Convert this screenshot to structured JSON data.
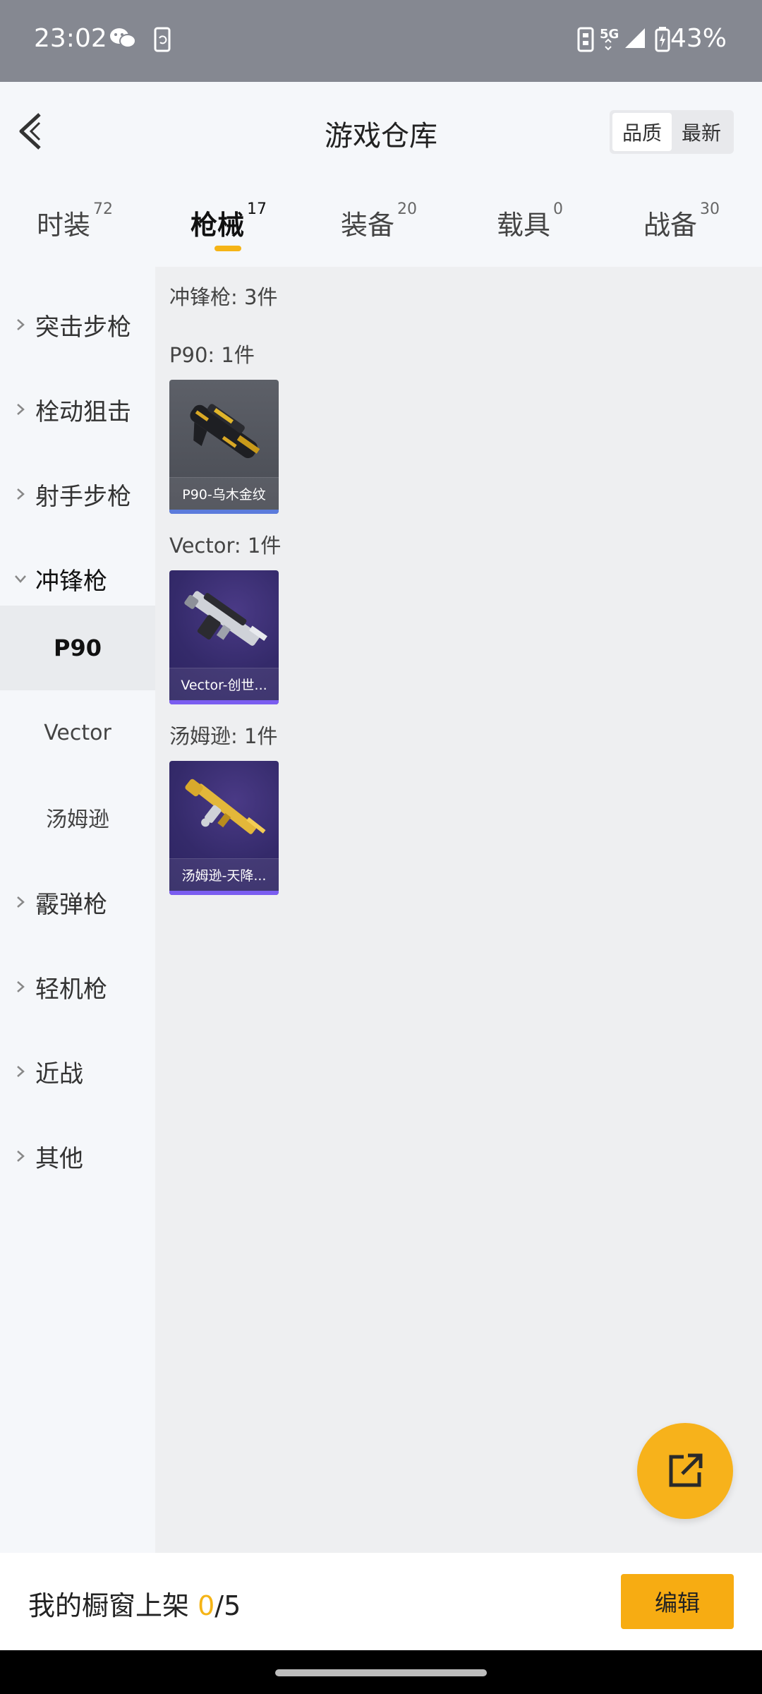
{
  "status_bar": {
    "time": "23:02",
    "battery": "43%",
    "icons": [
      "wechat-icon",
      "phone-sync-icon",
      "nfc-icon",
      "5g-icon",
      "signal-icon",
      "battery-charging-icon"
    ]
  },
  "header": {
    "title": "游戏仓库",
    "sort_options": [
      "品质",
      "最新"
    ],
    "active_sort": "品质"
  },
  "tabs": [
    {
      "label": "时装",
      "count": "72"
    },
    {
      "label": "枪械",
      "count": "17"
    },
    {
      "label": "装备",
      "count": "20"
    },
    {
      "label": "载具",
      "count": "0"
    },
    {
      "label": "战备",
      "count": "30"
    }
  ],
  "active_tab": "枪械",
  "sidebar": {
    "categories": [
      "突击步枪",
      "栓动狙击",
      "射手步枪",
      "冲锋枪",
      "霰弹枪",
      "轻机枪",
      "近战",
      "其他"
    ],
    "expanded": "冲锋枪",
    "subitems": [
      "P90",
      "Vector",
      "汤姆逊"
    ],
    "active_subitem": "P90"
  },
  "main": {
    "category_summary": "冲锋枪: 3件",
    "groups": [
      {
        "title": "P90: 1件",
        "item": {
          "name": "P90-乌木金纹",
          "rarity_color": "#5b7bdc"
        }
      },
      {
        "title": "Vector: 1件",
        "item": {
          "name": "Vector-创世...",
          "rarity_color": "#7a5df0"
        }
      },
      {
        "title": "汤姆逊: 1件",
        "item": {
          "name": "汤姆逊-天降...",
          "rarity_color": "#7a5df0"
        }
      }
    ]
  },
  "bottom_bar": {
    "label": "我的橱窗上架",
    "count": "0",
    "total": "/5",
    "edit_label": "编辑"
  },
  "colors": {
    "accent": "#f5b416",
    "button": "#f7ac12"
  },
  "fab_icon": "share-external-icon"
}
